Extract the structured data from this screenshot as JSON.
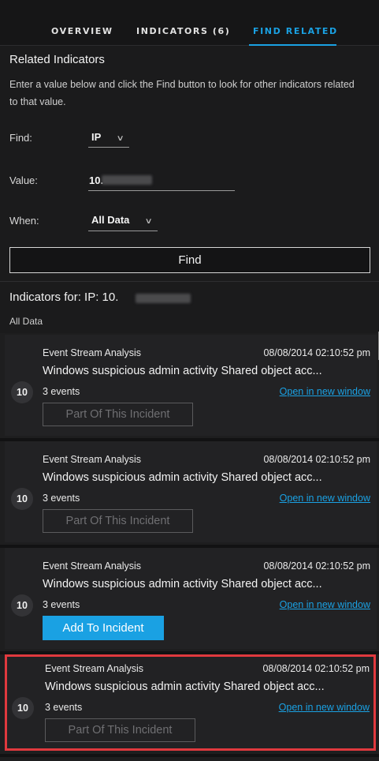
{
  "tabs": [
    "OVERVIEW",
    "INDICATORS (6)",
    "FIND RELATED"
  ],
  "active_tab": "FIND RELATED",
  "form": {
    "heading": "Related Indicators",
    "description": "Enter a value below and click the Find button to look for other indicators related to that value.",
    "find_label": "Find:",
    "find_value": "IP",
    "value_label": "Value:",
    "value_visible": "10.",
    "when_label": "When:",
    "when_value": "All Data",
    "find_button": "Find"
  },
  "results": {
    "heading": "Indicators for: IP: 10.",
    "timeframe": "All Data",
    "items": [
      {
        "source": "Event Stream Analysis",
        "timestamp": "08/08/2014 02:10:52 pm",
        "title": "Windows suspicious admin activity Shared object acc...",
        "count": "10",
        "events": "3 events",
        "link": "Open in new window",
        "action": "Part Of This Incident",
        "action_state": "disabled",
        "highlighted": false
      },
      {
        "source": "Event Stream Analysis",
        "timestamp": "08/08/2014 02:10:52 pm",
        "title": "Windows suspicious admin activity Shared object acc...",
        "count": "10",
        "events": "3 events",
        "link": "Open in new window",
        "action": "Part Of This Incident",
        "action_state": "disabled",
        "highlighted": false
      },
      {
        "source": "Event Stream Analysis",
        "timestamp": "08/08/2014 02:10:52 pm",
        "title": "Windows suspicious admin activity Shared object acc...",
        "count": "10",
        "events": "3 events",
        "link": "Open in new window",
        "action": "Add To Incident",
        "action_state": "primary",
        "highlighted": false
      },
      {
        "source": "Event Stream Analysis",
        "timestamp": "08/08/2014 02:10:52 pm",
        "title": "Windows suspicious admin activity Shared object acc...",
        "count": "10",
        "events": "3 events",
        "link": "Open in new window",
        "action": "Part Of This Incident",
        "action_state": "disabled",
        "highlighted": true
      }
    ]
  },
  "icons": {
    "dropdown": "chevron-down-icon"
  },
  "colors": {
    "background": "#1b1b1c",
    "accent": "#1aa1e3",
    "highlight_border": "#e0393e",
    "disabled_text": "#6f6f72"
  }
}
